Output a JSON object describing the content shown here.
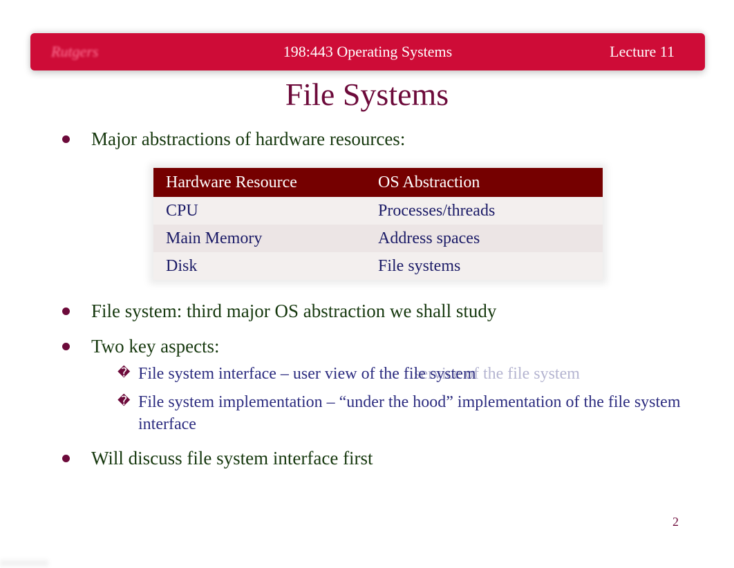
{
  "header": {
    "logo_text": "Rutgers",
    "course": "198:443 Operating Systems",
    "lecture": "Lecture 11"
  },
  "title": "File Systems",
  "bullets": {
    "b1": "Major abstractions of hardware resources:",
    "b2": "File system: third major OS abstraction we shall study",
    "b3": "Two key aspects:",
    "b3_sub1_front": "File system interface – user view of the file system",
    "b3_sub1_ghost": "service of the file system",
    "b3_sub2": "File system implementation – “under the hood” implementation of the file system interface",
    "b4": "Will discuss file system interface first"
  },
  "table": {
    "headers": {
      "c1": "Hardware Resource",
      "c2": "OS Abstraction"
    },
    "rows": [
      {
        "c1": "CPU",
        "c2": "Processes/threads"
      },
      {
        "c1": "Main Memory",
        "c2": "Address spaces"
      },
      {
        "c1": "Disk",
        "c2": "File systems"
      }
    ]
  },
  "page_number": "2"
}
